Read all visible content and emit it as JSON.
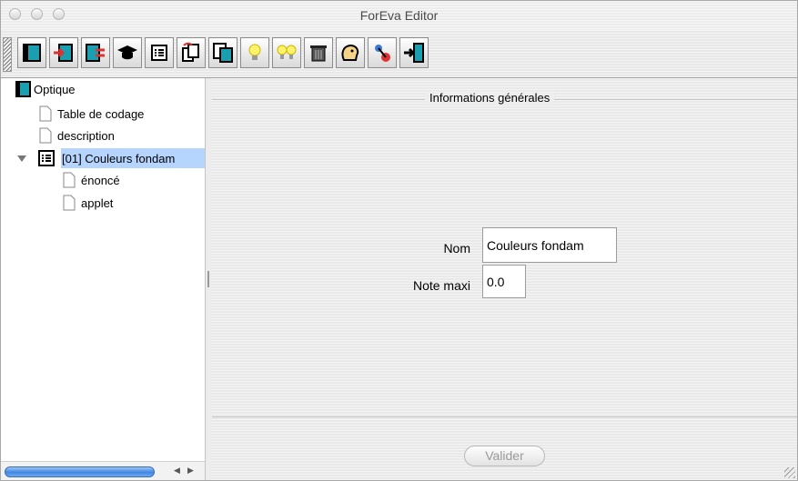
{
  "window": {
    "title": "ForEva Editor"
  },
  "toolbar": {
    "buttons": [
      {
        "name": "book-icon"
      },
      {
        "name": "book-import-icon"
      },
      {
        "name": "book-swap-icon"
      },
      {
        "name": "graduation-cap-icon"
      },
      {
        "name": "list-page-icon"
      },
      {
        "name": "pages-cycle-icon"
      },
      {
        "name": "pages-copy-icon"
      },
      {
        "name": "bulb-icon"
      },
      {
        "name": "double-bulb-icon"
      },
      {
        "name": "trash-icon"
      },
      {
        "name": "head-icon"
      },
      {
        "name": "network-icon"
      },
      {
        "name": "exit-door-icon"
      }
    ]
  },
  "tree": {
    "root": {
      "label": "Optique"
    },
    "items": [
      {
        "label": "Table de codage"
      },
      {
        "label": "description"
      },
      {
        "label": "[01] Couleurs fondam"
      },
      {
        "label": "énoncé"
      },
      {
        "label": "applet"
      }
    ]
  },
  "panel": {
    "legend": "Informations générales",
    "nom_label": "Nom",
    "nom_value": "Couleurs fondam",
    "note_label": "Note maxi",
    "note_value": "0.0",
    "submit_label": "Valider"
  },
  "colors": {
    "selection": "#b5d5ff",
    "scroll_thumb": "#3f86e3"
  }
}
